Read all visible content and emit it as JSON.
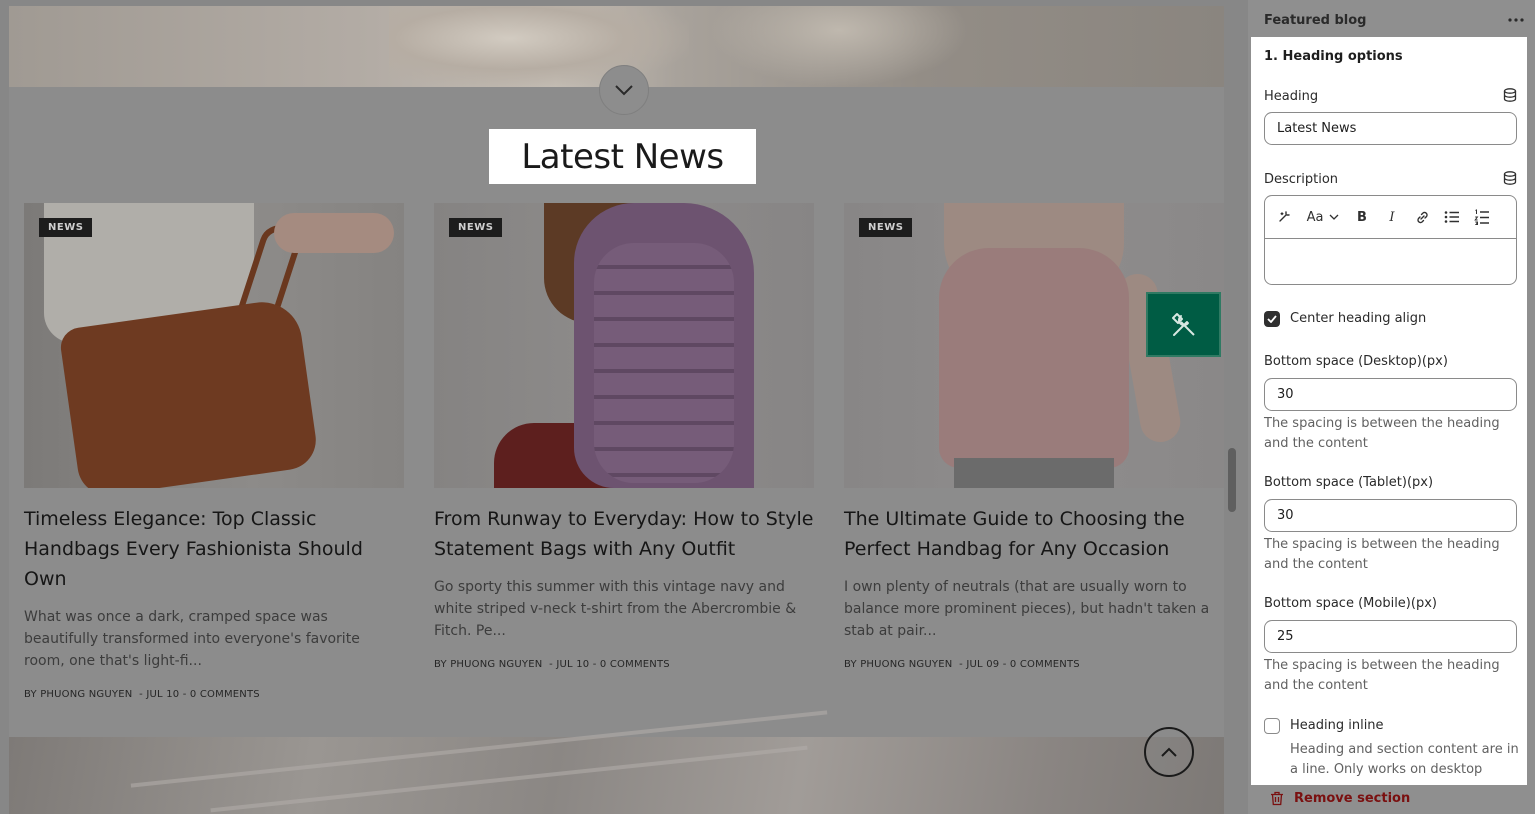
{
  "preview": {
    "section_heading": "Latest News",
    "posts": [
      {
        "badge": "NEWS",
        "title": "Timeless Elegance: Top Classic Handbags Every Fashionista Should Own",
        "excerpt": "What was once a dark, cramped space was beautifully transformed into everyone's favorite room, one that's light-fi...",
        "author": "BY PHUONG NGUYEN",
        "date": "JUL 10",
        "comments": "0 COMMENTS"
      },
      {
        "badge": "NEWS",
        "title": "From Runway to Everyday: How to Style Statement Bags with Any Outfit",
        "excerpt": "Go sporty this summer with this vintage navy and white striped v-neck t-shirt from the Abercrombie & Fitch. Pe...",
        "author": "BY PHUONG NGUYEN",
        "date": "JUL 10",
        "comments": "0 COMMENTS"
      },
      {
        "badge": "NEWS",
        "title": "The Ultimate Guide to Choosing the Perfect Handbag for Any Occasion",
        "excerpt": "I own plenty of neutrals (that are usually worn to balance more prominent pieces), but hadn't taken a stab at pair...",
        "author": "BY PHUONG NGUYEN",
        "date": "JUL 09",
        "comments": "0 COMMENTS"
      }
    ],
    "meta_separator": "-",
    "icons": {
      "scroll_down": "chevron-down-icon",
      "tools": "wrench-screwdriver-icon",
      "scroll_up": "chevron-up-icon"
    },
    "colors": {
      "tool_button": "#005c44",
      "overlay": "#8c8c8c"
    }
  },
  "panel": {
    "title": "Featured blog",
    "more_icon": "more-horizontal-icon",
    "section_title": "1. Heading options",
    "heading_label": "Heading",
    "heading_value": "Latest News",
    "description_label": "Description",
    "rte_font_label": "Aa",
    "rte_bold": "B",
    "rte_italic": "I",
    "center_align_label": "Center heading align",
    "center_align_checked": true,
    "desktop_label": "Bottom space (Desktop)(px)",
    "desktop_value": "30",
    "tablet_label": "Bottom space (Tablet)(px)",
    "tablet_value": "30",
    "mobile_label": "Bottom space (Mobile)(px)",
    "mobile_value": "25",
    "spacing_help": "The spacing is between the heading and the content",
    "inline_label": "Heading inline",
    "inline_checked": false,
    "inline_help": "Heading and section content are in a line. Only works on desktop",
    "remove_label": "Remove section",
    "colors": {
      "remove": "#7a1010"
    }
  }
}
